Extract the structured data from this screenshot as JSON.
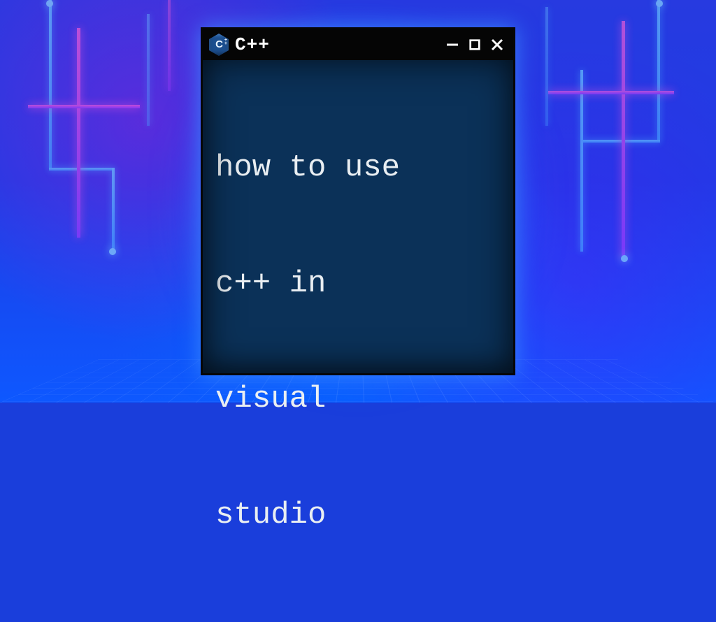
{
  "window": {
    "title": "C++",
    "icon_label": "C++",
    "controls": {
      "minimize": "minimize",
      "maximize": "maximize",
      "close": "close"
    }
  },
  "content": {
    "lines": [
      "how to use",
      "c++ in",
      "visual",
      "studio"
    ]
  },
  "colors": {
    "titlebar": "#050505",
    "window_bg": "#0b3158",
    "text": "#e9eef2",
    "glow": "#4aa0ff"
  }
}
